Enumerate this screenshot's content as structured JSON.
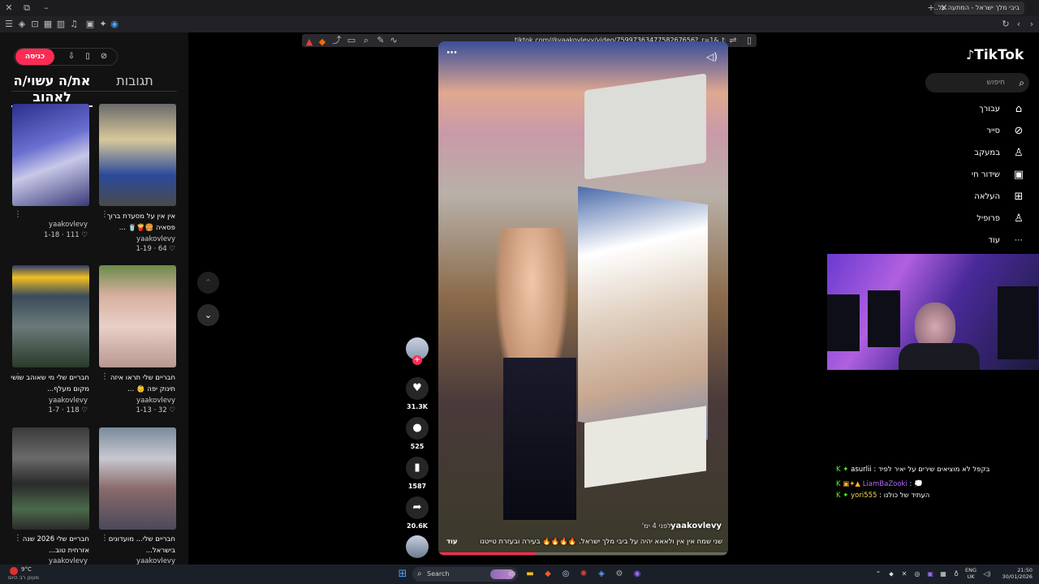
{
  "browser": {
    "tab_title": "ביבי מלך ישראל - המתעה על...",
    "url": "tiktok.com/@yaakovlevy/video/7599736347758267656?_r=1&_t=ZS-93RZMaTdjPx"
  },
  "left": {
    "login_label": "כניסה",
    "tab_liked": "את/ה עשוי/ה לאהוב",
    "tab_replies": "תגובות",
    "cards": [
      {
        "caption": "",
        "author": "yaakovlevy",
        "stats": "1-18 · 111 ♡"
      },
      {
        "caption": "אין אין על מסעדת ברוך פסאיה 🍔🍟🥤 ...",
        "author": "yaakovlevy",
        "stats": "1-19 · 64 ♡"
      },
      {
        "caption": "חבריים שלי מי שאוהב שושי מקום מעלף...",
        "author": "yaakovlevy",
        "stats": "1-7 · 118 ♡"
      },
      {
        "caption": "חבריים שלי תראו איזה תינוק יפה 👶 ...",
        "author": "yaakovlevy",
        "stats": "1-13 · 32 ♡"
      },
      {
        "caption": "חבריים שלי 2026 שנה אזרחית טוב...",
        "author": "yaakovlevy",
        "stats": ""
      },
      {
        "caption": "חבריים שלי... מועדונים בישראל...",
        "author": "yaakovlevy",
        "stats": ""
      }
    ]
  },
  "video": {
    "author": "yaakovlevy",
    "time_ago": "לפני 4 ימ'",
    "caption": "שני שמח   אין אין ולאאא יהיה על ביבי מלך ישראל. 🔥🔥🔥🔥 בעירה ובעזרת טייטנו",
    "more_label": "עוד",
    "likes": "31.3K",
    "comments": "525",
    "saves": "1587",
    "shares": "20.6K"
  },
  "nav": {
    "logo": "TikTok",
    "search_placeholder": "חיפוש",
    "items": [
      "עבורך",
      "סייר",
      "במעקב",
      "שידור חי",
      "העלאה",
      "פרופיל",
      "עוד"
    ]
  },
  "chat": [
    {
      "user": "asurlii",
      "text": ": בקפל לא מוציאים שירים על יאיר לפיד",
      "color": "#ffffff"
    },
    {
      "user": "LiamBaZooki",
      "text": ": 💭",
      "color": "#b36bff"
    },
    {
      "user": "yori555",
      "text": ": העתיד של כולנו",
      "color": "#ffd24d"
    }
  ],
  "taskbar": {
    "weather_temp": "9°C",
    "weather_text": "מעונן רב היום",
    "search_label": "Search",
    "lang_top": "ENG",
    "lang_bottom": "UK",
    "time": "21:50",
    "date": "30/01/2026"
  }
}
